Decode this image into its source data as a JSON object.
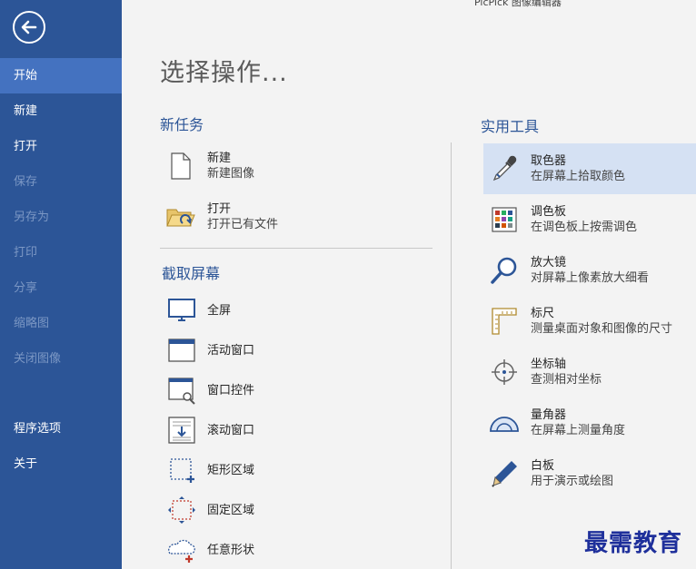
{
  "app_title": "PicPick 图像编辑器",
  "page_title": "选择操作...",
  "sidebar": {
    "items": [
      {
        "label": "开始",
        "state": "active"
      },
      {
        "label": "新建",
        "state": "normal"
      },
      {
        "label": "打开",
        "state": "normal"
      },
      {
        "label": "保存",
        "state": "disabled"
      },
      {
        "label": "另存为",
        "state": "disabled"
      },
      {
        "label": "打印",
        "state": "disabled"
      },
      {
        "label": "分享",
        "state": "disabled"
      },
      {
        "label": "缩略图",
        "state": "disabled"
      },
      {
        "label": "关闭图像",
        "state": "disabled"
      },
      {
        "label": "程序选项",
        "state": "normal"
      },
      {
        "label": "关于",
        "state": "normal"
      }
    ]
  },
  "new_task": {
    "title": "新任务",
    "items": [
      {
        "label": "新建",
        "desc": "新建图像",
        "icon": "new-file-icon"
      },
      {
        "label": "打开",
        "desc": "打开已有文件",
        "icon": "open-folder-icon"
      }
    ]
  },
  "capture": {
    "title": "截取屏幕",
    "items": [
      {
        "label": "全屏",
        "icon": "monitor-icon"
      },
      {
        "label": "活动窗口",
        "icon": "window-icon"
      },
      {
        "label": "窗口控件",
        "icon": "window-control-icon"
      },
      {
        "label": "滚动窗口",
        "icon": "scroll-window-icon"
      },
      {
        "label": "矩形区域",
        "icon": "rect-region-icon"
      },
      {
        "label": "固定区域",
        "icon": "fixed-region-icon"
      },
      {
        "label": "任意形状",
        "icon": "freeform-region-icon"
      }
    ]
  },
  "tools": {
    "title": "实用工具",
    "items": [
      {
        "label": "取色器",
        "desc": "在屏幕上拾取颜色",
        "icon": "eyedropper-icon"
      },
      {
        "label": "调色板",
        "desc": "在调色板上按需调色",
        "icon": "palette-icon"
      },
      {
        "label": "放大镜",
        "desc": "对屏幕上像素放大细看",
        "icon": "magnifier-icon"
      },
      {
        "label": "标尺",
        "desc": "测量桌面对象和图像的尺寸",
        "icon": "ruler-icon"
      },
      {
        "label": "坐标轴",
        "desc": "查测相对坐标",
        "icon": "crosshair-icon"
      },
      {
        "label": "量角器",
        "desc": "在屏幕上测量角度",
        "icon": "protractor-icon"
      },
      {
        "label": "白板",
        "desc": "用于演示或绘图",
        "icon": "pen-icon"
      }
    ]
  },
  "watermark": "最需教育",
  "colors": {
    "sidebar": "#2c5597",
    "sidebar_active": "#4472c0",
    "accent": "#2c5597",
    "highlight": "#d5e1f3"
  }
}
